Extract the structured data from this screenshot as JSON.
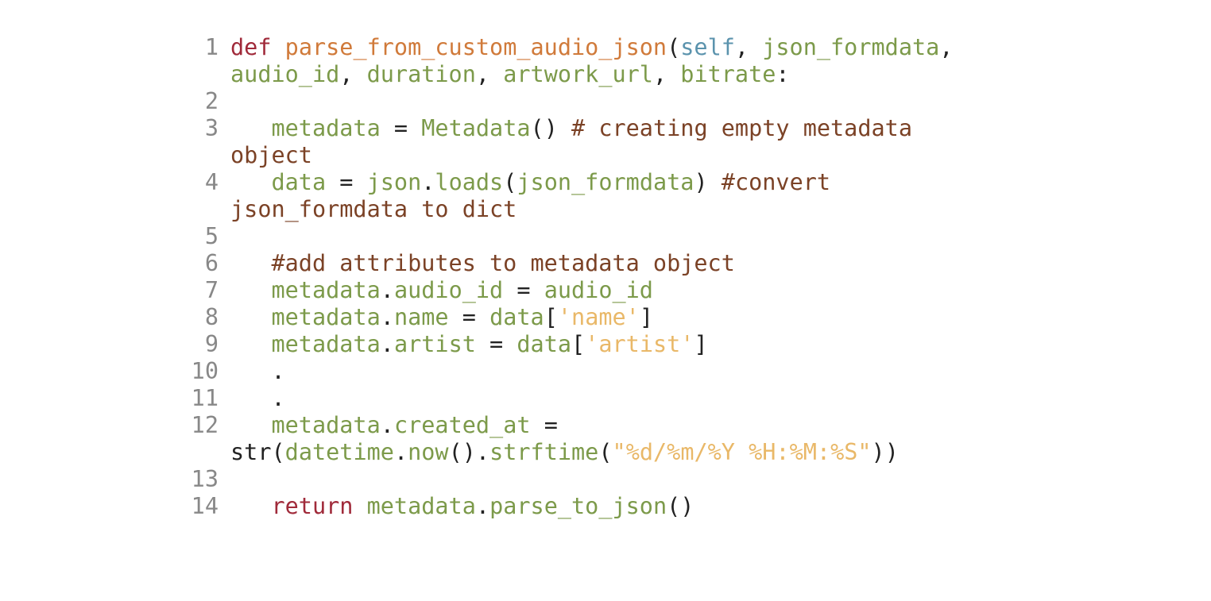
{
  "lines": [
    {
      "num": "1"
    },
    {
      "num": "2"
    },
    {
      "num": "3"
    },
    {
      "num": "4"
    },
    {
      "num": "5"
    },
    {
      "num": "6"
    },
    {
      "num": "7"
    },
    {
      "num": "8"
    },
    {
      "num": "9"
    },
    {
      "num": "10"
    },
    {
      "num": "11"
    },
    {
      "num": "12"
    },
    {
      "num": "13"
    },
    {
      "num": "14"
    }
  ],
  "tokens": {
    "l1_def": "def",
    "l1_fname": "parse_from_custom_audio_json",
    "l1_self": "self",
    "l1_p1": "json_formdata",
    "l1_p2": "audio_id",
    "l1_p3": "duration",
    "l1_p4": "artwork_url",
    "l1_p5": "bitrate",
    "l3_var": "metadata",
    "l3_cls": "Metadata",
    "l3_cm": "# creating empty metadata object",
    "l4_var": "data",
    "l4_mod": "json",
    "l4_fn": "loads",
    "l4_arg": "json_formdata",
    "l4_cm": "#convert json_formdata to dict",
    "l6_cm": "#add attributes to metadata object",
    "l7_obj": "metadata",
    "l7_attr": "audio_id",
    "l7_val": "audio_id",
    "l8_obj": "metadata",
    "l8_attr": "name",
    "l8_data": "data",
    "l8_key": "'name'",
    "l9_obj": "metadata",
    "l9_attr": "artist",
    "l9_data": "data",
    "l9_key": "'artist'",
    "l10_dot": ".",
    "l11_dot": ".",
    "l12_obj": "metadata",
    "l12_attr": "created_at",
    "l12_str": "str",
    "l12_mod": "datetime",
    "l12_now": "now",
    "l12_fmt": "strftime",
    "l12_arg": "\"%d/%m/%Y %H:%M:%S\"",
    "l14_ret": "return",
    "l14_obj": "metadata",
    "l14_fn": "parse_to_json"
  }
}
